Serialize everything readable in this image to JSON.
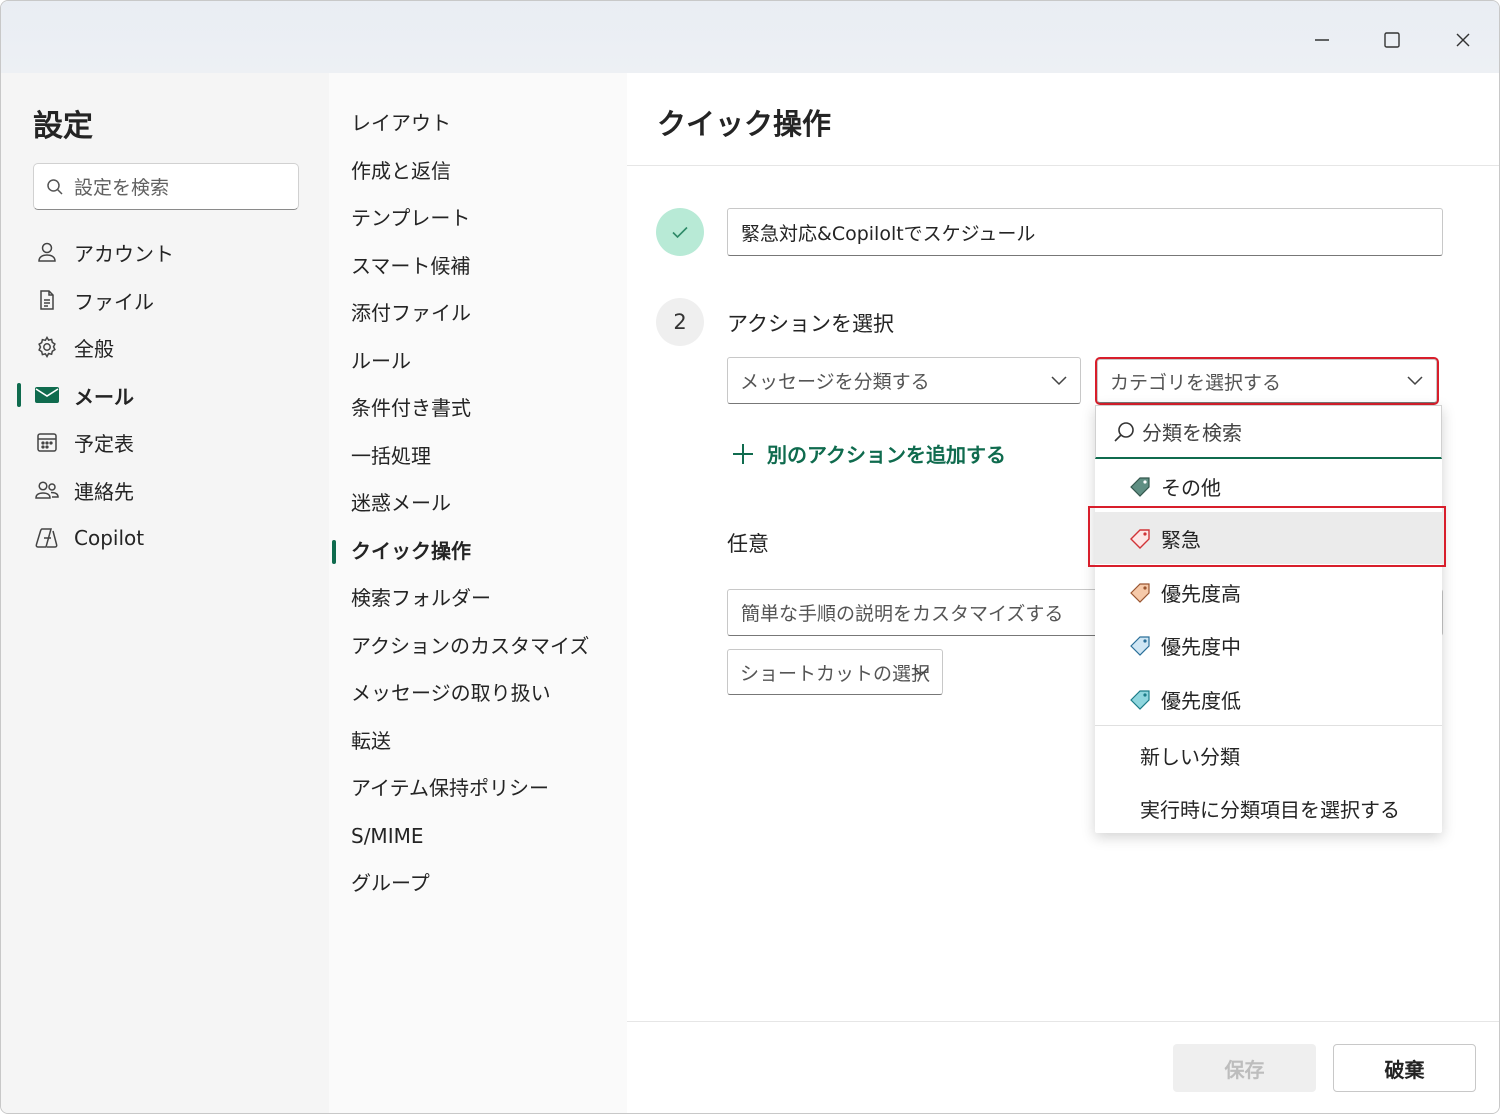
{
  "window": {
    "controls": {
      "minimize": "minimize-icon",
      "maximize": "maximize-icon",
      "close": "close-icon"
    }
  },
  "sidebar": {
    "title": "設定",
    "search_placeholder": "設定を検索",
    "items": [
      {
        "label": "アカウント",
        "icon": "person-icon"
      },
      {
        "label": "ファイル",
        "icon": "document-icon"
      },
      {
        "label": "全般",
        "icon": "gear-icon"
      },
      {
        "label": "メール",
        "icon": "mail-icon",
        "active": true
      },
      {
        "label": "予定表",
        "icon": "calendar-icon"
      },
      {
        "label": "連絡先",
        "icon": "people-icon"
      },
      {
        "label": "Copilot",
        "icon": "copilot-icon"
      }
    ]
  },
  "submenu": {
    "items": [
      "レイアウト",
      "作成と返信",
      "テンプレート",
      "スマート候補",
      "添付ファイル",
      "ルール",
      "条件付き書式",
      "一括処理",
      "迷惑メール",
      "クイック操作",
      "検索フォルダー",
      "アクションのカスタマイズ",
      "メッセージの取り扱い",
      "転送",
      "アイテム保持ポリシー",
      "S/MIME",
      "グループ"
    ],
    "active": "クイック操作"
  },
  "main": {
    "title": "クイック操作",
    "name_value": "緊急対応&Copiloltでスケジュール",
    "step2_number": "2",
    "step2_label": "アクションを選択",
    "action_select": "メッセージを分類する",
    "category_select": "カテゴリを選択する",
    "add_action": "別のアクションを追加する",
    "optional_label": "任意",
    "description_placeholder": "簡単な手順の説明をカスタマイズする",
    "shortcut_select": "ショートカットの選択",
    "save": "保存",
    "discard": "破棄"
  },
  "category_popup": {
    "search_placeholder": "分類を検索",
    "categories": [
      {
        "label": "その他",
        "color": "#5f8f83"
      },
      {
        "label": "緊急",
        "color": "#d13438",
        "selected": true
      },
      {
        "label": "優先度高",
        "color": "#c8764a"
      },
      {
        "label": "優先度中",
        "color": "#3a8bb5"
      },
      {
        "label": "優先度低",
        "color": "#2aa8b8"
      }
    ],
    "new_category": "新しい分類",
    "select_at_runtime": "実行時に分類項目を選択する"
  },
  "colors": {
    "accent": "#0f6b4e",
    "highlight": "#d81e2b",
    "done_circle": "#b8ead6"
  }
}
